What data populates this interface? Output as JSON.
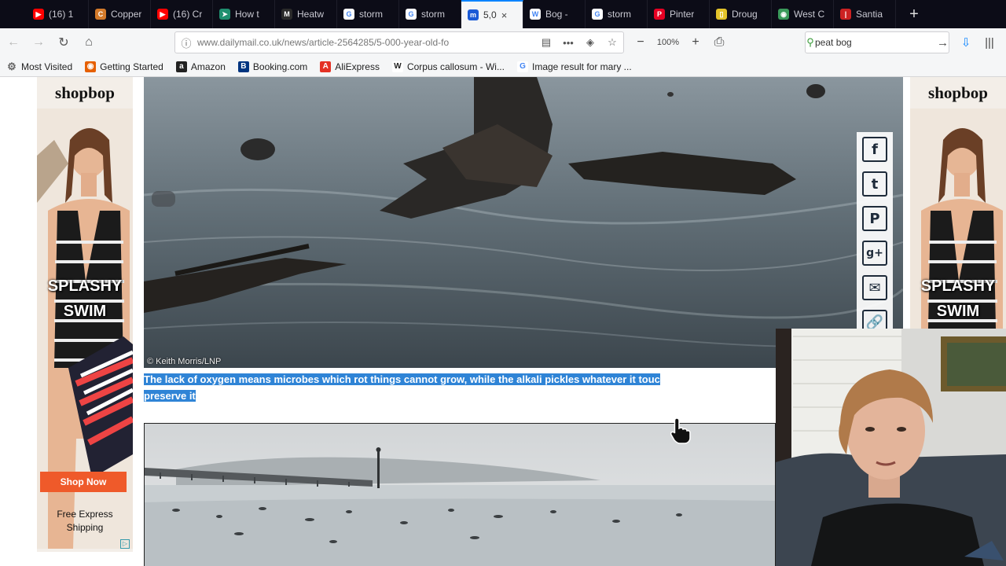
{
  "tabs": [
    {
      "label": "(16) 1",
      "icon": "youtube-icon",
      "color": "#ff0000",
      "glyph": "▶"
    },
    {
      "label": "Copper",
      "icon": "copper-icon",
      "color": "#d37a2a",
      "glyph": "C"
    },
    {
      "label": "(16) Cr",
      "icon": "youtube-icon",
      "color": "#ff0000",
      "glyph": "▶"
    },
    {
      "label": "How t",
      "icon": "arrow-icon",
      "color": "#1f8f6f",
      "glyph": "➤"
    },
    {
      "label": "Heatw",
      "icon": "m-logo-icon",
      "color": "#2a2a2a",
      "glyph": "M"
    },
    {
      "label": "storm",
      "icon": "google-icon",
      "color": "#ffffff",
      "glyph": "G"
    },
    {
      "label": "storm",
      "icon": "google-icon",
      "color": "#ffffff",
      "glyph": "G"
    },
    {
      "label": "5,0",
      "icon": "dailymail-icon",
      "color": "#1a5ad6",
      "glyph": "m",
      "active": true
    },
    {
      "label": "Bog - ",
      "icon": "wikipedia-icon",
      "color": "#ffffff",
      "glyph": "W"
    },
    {
      "label": "storm",
      "icon": "google-icon",
      "color": "#ffffff",
      "glyph": "G"
    },
    {
      "label": "Pinter",
      "icon": "pinterest-icon",
      "color": "#e60023",
      "glyph": "P"
    },
    {
      "label": "Droug",
      "icon": "drought-icon",
      "color": "#e2c32a",
      "glyph": "▯"
    },
    {
      "label": "West C",
      "icon": "globe-icon",
      "color": "#3a9a5a",
      "glyph": "◉"
    },
    {
      "label": "Santia",
      "icon": "santiago-icon",
      "color": "#cc2222",
      "glyph": "|"
    }
  ],
  "new_tab_glyph": "+",
  "nav": {
    "url": "www.dailymail.co.uk/news/article-2564285/5-000-year-old-fo",
    "zoom": "100%",
    "search_value": "peat bog"
  },
  "bookmarks": [
    {
      "label": "Most Visited",
      "icon": "gear-icon",
      "color": "#666666",
      "glyph": "⚙"
    },
    {
      "label": "Getting Started",
      "icon": "firefox-icon",
      "color": "#e66000",
      "glyph": "◉"
    },
    {
      "label": "Amazon",
      "icon": "amazon-icon",
      "color": "#222222",
      "glyph": "a"
    },
    {
      "label": "Booking.com",
      "icon": "booking-icon",
      "color": "#003580",
      "glyph": "B"
    },
    {
      "label": "AliExpress",
      "icon": "aliexpress-icon",
      "color": "#e43225",
      "glyph": "A"
    },
    {
      "label": "Corpus callosum - Wi...",
      "icon": "wikipedia-icon",
      "color": "#ffffff",
      "glyph": "W"
    },
    {
      "label": "Image result for mary ...",
      "icon": "google-icon",
      "color": "#ffffff",
      "glyph": "G"
    }
  ],
  "ad": {
    "brand": "shopbop",
    "slogan_line1": "SPLASHY",
    "slogan_line2": "SWIM",
    "shop_label": "Shop Now",
    "ship_line1": "Free Express",
    "ship_line2": "Shipping"
  },
  "article": {
    "photo_credit": "© Keith Morris/LNP",
    "caption_line1": "The lack of oxygen means microbes which rot things cannot grow, while the alkali pickles whatever it touc",
    "caption_line2": "preserve it"
  },
  "share": [
    {
      "name": "share-facebook",
      "icon": "facebook-icon",
      "glyph": "f"
    },
    {
      "name": "share-twitter",
      "icon": "twitter-icon",
      "glyph": "t"
    },
    {
      "name": "share-pinterest",
      "icon": "pinterest-icon",
      "glyph": "P"
    },
    {
      "name": "share-googleplus",
      "icon": "googleplus-icon",
      "glyph": "g+"
    },
    {
      "name": "share-email",
      "icon": "email-icon",
      "glyph": "✉"
    },
    {
      "name": "share-link",
      "icon": "link-icon",
      "glyph": "🔗"
    }
  ],
  "colors": {
    "tab_strip": "#0c0c17",
    "caption_highlight": "#2f84d6",
    "shop_button": "#ef5a2a",
    "accent": "#0a84ff"
  }
}
